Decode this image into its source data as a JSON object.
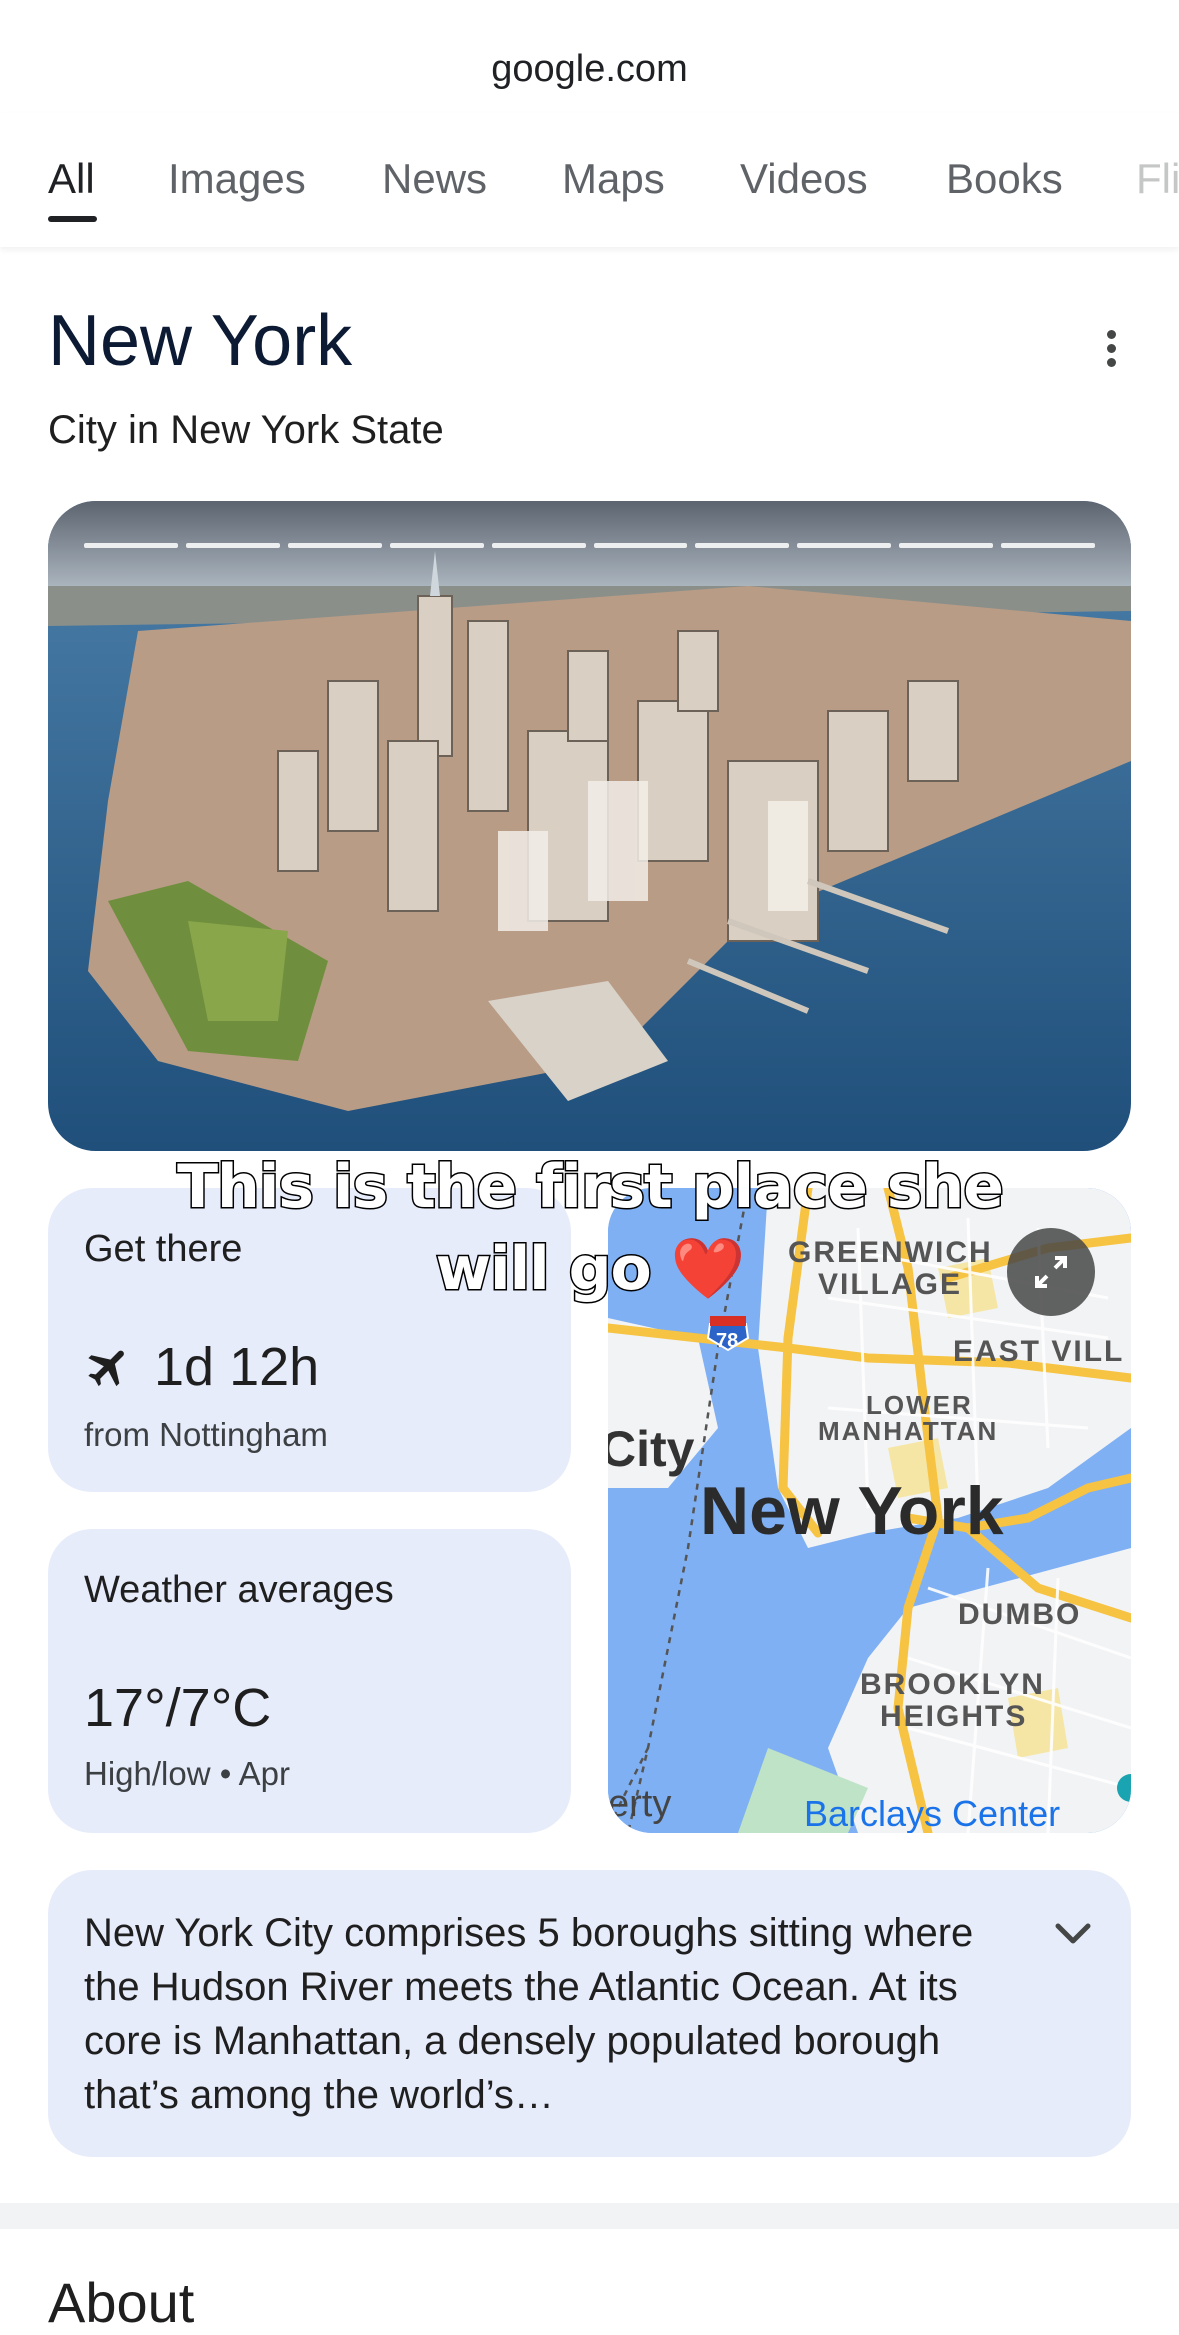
{
  "browser": {
    "url": "google.com"
  },
  "tabs": [
    {
      "label": "All",
      "active": true
    },
    {
      "label": "Images"
    },
    {
      "label": "News"
    },
    {
      "label": "Maps"
    },
    {
      "label": "Videos"
    },
    {
      "label": "Books"
    },
    {
      "label": "Fli"
    }
  ],
  "entity": {
    "title": "New York",
    "subtitle": "City in New York State"
  },
  "get_there": {
    "label": "Get there",
    "value": "1d 12h",
    "detail": "from Nottingham",
    "icon": "airplane-icon"
  },
  "weather": {
    "label": "Weather averages",
    "value": "17°/7°C",
    "detail": "High/low • Apr"
  },
  "map": {
    "labels": {
      "greenwich": "GREENWICH",
      "village": "VILLAGE",
      "east_village": "EAST VILL",
      "lower": "LOWER",
      "manhattan": "MANHATTAN",
      "city": "City",
      "new_york": "New York",
      "dumbo": "DUMBO",
      "brooklyn": "BROOKLYN",
      "heights": "HEIGHTS",
      "liberty": "erty",
      "barclays": "Barclays Center",
      "route": "78"
    },
    "colors": {
      "water": "#7fb0f3",
      "land": "#f2f3f5",
      "highway": "#f6c342",
      "park": "#bfe3c7"
    }
  },
  "description": {
    "text": "New York City comprises 5 boroughs sitting where the Hudson River meets the Atlantic Ocean. At its core is Manhattan, a densely populated borough that’s among the world’s…"
  },
  "about": {
    "heading": "About"
  },
  "overlay": {
    "line1": "This is the first place she",
    "line2": "will go",
    "emoji": "❤️"
  }
}
